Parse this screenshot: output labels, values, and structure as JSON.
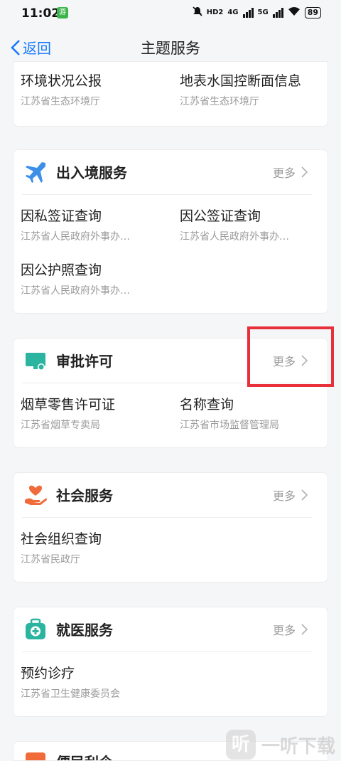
{
  "status_bar": {
    "time": "11:02",
    "app_badge": "游",
    "hd": "HD2",
    "net4g": "4G",
    "net5g": "5G",
    "battery": "89"
  },
  "nav": {
    "back_label": "返回",
    "title": "主题服务"
  },
  "top_partial": {
    "items": [
      {
        "name": "环境状况公报",
        "dept": "江苏省生态环境厅"
      },
      {
        "name": "地表水国控断面信息",
        "dept": "江苏省生态环境厅"
      }
    ]
  },
  "sections": [
    {
      "title": "出入境服务",
      "more": "更多",
      "icon": "airplane-icon",
      "icon_color": "#3d8fe8",
      "items": [
        {
          "name": "因私签证查询",
          "dept": "江苏省人民政府外事办…"
        },
        {
          "name": "因公签证查询",
          "dept": "江苏省人民政府外事办…"
        },
        {
          "name": "因公护照查询",
          "dept": "江苏省人民政府外事办…"
        }
      ]
    },
    {
      "title": "审批许可",
      "more": "更多",
      "icon": "approval-monitor-icon",
      "icon_color": "#2bb5a0",
      "items": [
        {
          "name": "烟草零售许可证",
          "dept": "江苏省烟草专卖局"
        },
        {
          "name": "名称查询",
          "dept": "江苏省市场监督管理局"
        }
      ]
    },
    {
      "title": "社会服务",
      "more": "更多",
      "icon": "hand-heart-icon",
      "icon_color": "#f06a3a",
      "items": [
        {
          "name": "社会组织查询",
          "dept": "江苏省民政厅"
        }
      ]
    },
    {
      "title": "就医服务",
      "more": "更多",
      "icon": "medical-kit-icon",
      "icon_color": "#2bb5a0",
      "items": [
        {
          "name": "预约诊疗",
          "dept": "江苏省卫生健康委员会"
        }
      ]
    },
    {
      "title": "便民利企",
      "more": "",
      "icon": "convenience-icon",
      "icon_color": "#f06a3a",
      "items": []
    }
  ],
  "watermark": {
    "logo": "听",
    "text": "一听下载"
  },
  "highlight_color": "#e8303a"
}
